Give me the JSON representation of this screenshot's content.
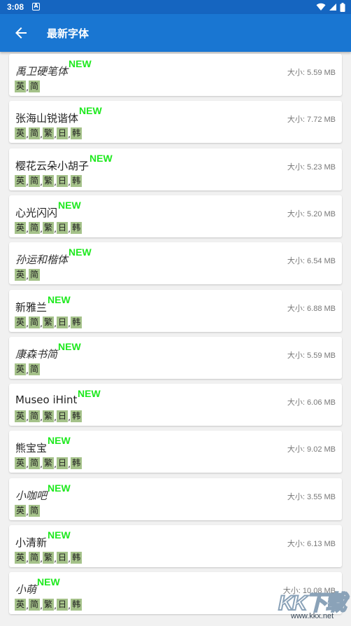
{
  "status_bar": {
    "time": "3:08",
    "notification": "A"
  },
  "app_bar": {
    "title": "最新字体"
  },
  "new_label": "NEW",
  "fonts": [
    {
      "name": "禹卫硬笔体",
      "size": "大小: 5.59 MB",
      "langs": [
        "英",
        "简"
      ]
    },
    {
      "name": "张海山锐谐体",
      "size": "大小: 7.72 MB",
      "langs": [
        "英",
        "简",
        "繁",
        "日",
        "韩"
      ]
    },
    {
      "name": "樱花云朵小胡子",
      "size": "大小: 5.23 MB",
      "langs": [
        "英",
        "简",
        "繁",
        "日",
        "韩"
      ]
    },
    {
      "name": "心光闪闪",
      "size": "大小: 5.20 MB",
      "langs": [
        "英",
        "简",
        "繁",
        "日",
        "韩"
      ]
    },
    {
      "name": "孙运和楷体",
      "size": "大小: 6.54 MB",
      "langs": [
        "英",
        "简"
      ]
    },
    {
      "name": "新雅兰",
      "size": "大小: 6.88 MB",
      "langs": [
        "英",
        "简",
        "繁",
        "日",
        "韩"
      ]
    },
    {
      "name": "康森书简",
      "size": "大小: 5.59 MB",
      "langs": [
        "英",
        "简"
      ]
    },
    {
      "name": "Museo iHint",
      "size": "大小: 6.06 MB",
      "langs": [
        "英",
        "简",
        "繁",
        "日",
        "韩"
      ]
    },
    {
      "name": "熊宝宝",
      "size": "大小: 9.02 MB",
      "langs": [
        "英",
        "简",
        "繁",
        "日",
        "韩"
      ]
    },
    {
      "name": "小咖吧",
      "size": "大小: 3.55 MB",
      "langs": [
        "英",
        "简"
      ]
    },
    {
      "name": "小清新",
      "size": "大小: 6.13 MB",
      "langs": [
        "英",
        "简",
        "繁",
        "日",
        "韩"
      ]
    },
    {
      "name": "小萌",
      "size": "大小: 10.08 MB",
      "langs": [
        "英",
        "简",
        "繁",
        "日",
        "韩"
      ]
    }
  ],
  "watermark": {
    "text": "KK下载",
    "url": "www.kkx.net"
  },
  "colors": {
    "status_bar": "#1565c0",
    "app_bar": "#1976d2",
    "new_badge": "#1ee91e",
    "lang_tag": "#a5c28a",
    "background": "#f1f1f1"
  }
}
